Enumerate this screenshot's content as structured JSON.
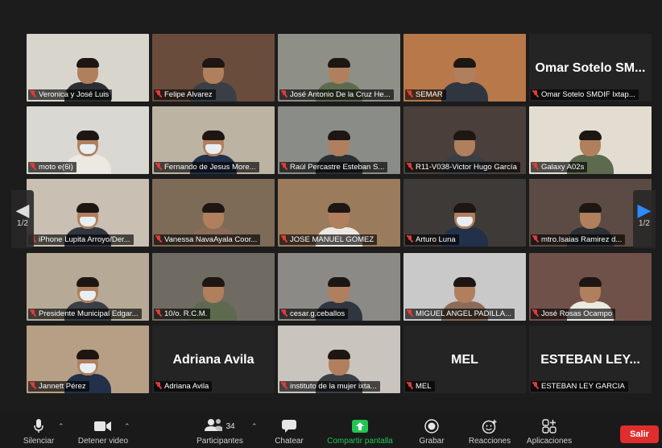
{
  "gallery": {
    "page_indicator": "1/2",
    "tiles": [
      {
        "name": "Veronica y José Luis",
        "type": "video",
        "bg": "#d8d5cc"
      },
      {
        "name": "Felipe Alvarez",
        "type": "video",
        "bg": "#6a4c3d"
      },
      {
        "name": "José Antonio De la Cruz He...",
        "type": "video",
        "bg": "#8e8f86"
      },
      {
        "name": "SEMAR",
        "type": "video",
        "bg": "#b9784a"
      },
      {
        "name": "Omar Sotelo SMDIF Ixtap...",
        "type": "text",
        "bigname": "Omar Sotelo SM...",
        "bg": "#242424"
      },
      {
        "name": "moto e(6i)",
        "type": "video",
        "bg": "#dad8d2"
      },
      {
        "name": "Fernando de Jesus More...",
        "type": "video",
        "bg": "#bcb3a3"
      },
      {
        "name": "Raúl Percastre Esteban S...",
        "type": "video",
        "bg": "#8a8c88"
      },
      {
        "name": "R11-V038-Victor Hugo García",
        "type": "video",
        "bg": "#4a3f3b"
      },
      {
        "name": "Galaxy A02s",
        "type": "video",
        "bg": "#e2ddd0"
      },
      {
        "name": "iPhone Lupita Arroyo/Der...",
        "type": "video",
        "bg": "#c9bfb3"
      },
      {
        "name": "Vanessa NavaAyala Coor...",
        "type": "video",
        "bg": "#7d6a57"
      },
      {
        "name": "JOSE MANUEL GOMEZ",
        "type": "video",
        "bg": "#9a7b5c"
      },
      {
        "name": "Arturo  Luna",
        "type": "video",
        "bg": "#3e3a38"
      },
      {
        "name": "mtro.Isaias Ramirez d...",
        "type": "video",
        "bg": "#5c4a44",
        "active": true
      },
      {
        "name": "Presidente Municipal Edgar...",
        "type": "video",
        "bg": "#b6aa97"
      },
      {
        "name": "10/o. R.C.M.",
        "type": "video",
        "bg": "#6f6a62"
      },
      {
        "name": "cesar.g.ceballos",
        "type": "video",
        "bg": "#8c8a86"
      },
      {
        "name": "MIGUEL ANGEL PADILLA...",
        "type": "video",
        "bg": "#c8c9c8"
      },
      {
        "name": "José Rosas Ocampo",
        "type": "video",
        "bg": "#70514a"
      },
      {
        "name": "Jannett Pérez",
        "type": "video",
        "bg": "#b79f86"
      },
      {
        "name": "Adriana Avila",
        "type": "text",
        "bigname": "Adriana Avila",
        "bg": "#242424"
      },
      {
        "name": "instituto de la mujer ixta...",
        "type": "video",
        "bg": "#c9c4be"
      },
      {
        "name": "MEL",
        "type": "text",
        "bigname": "MEL",
        "bg": "#242424"
      },
      {
        "name": "ESTEBAN LEY GARCIA",
        "type": "text",
        "bigname": "ESTEBAN LEY...",
        "bg": "#242424"
      }
    ]
  },
  "toolbar": {
    "mute_label": "Silenciar",
    "video_label": "Detener video",
    "participants_label": "Participantes",
    "participants_count": "34",
    "chat_label": "Chatear",
    "share_label": "Compartir pantalla",
    "record_label": "Grabar",
    "reactions_label": "Reacciones",
    "apps_label": "Aplicaciones",
    "leave_label": "Salir",
    "share_color": "#23c552",
    "leave_color": "#e02d2d"
  }
}
